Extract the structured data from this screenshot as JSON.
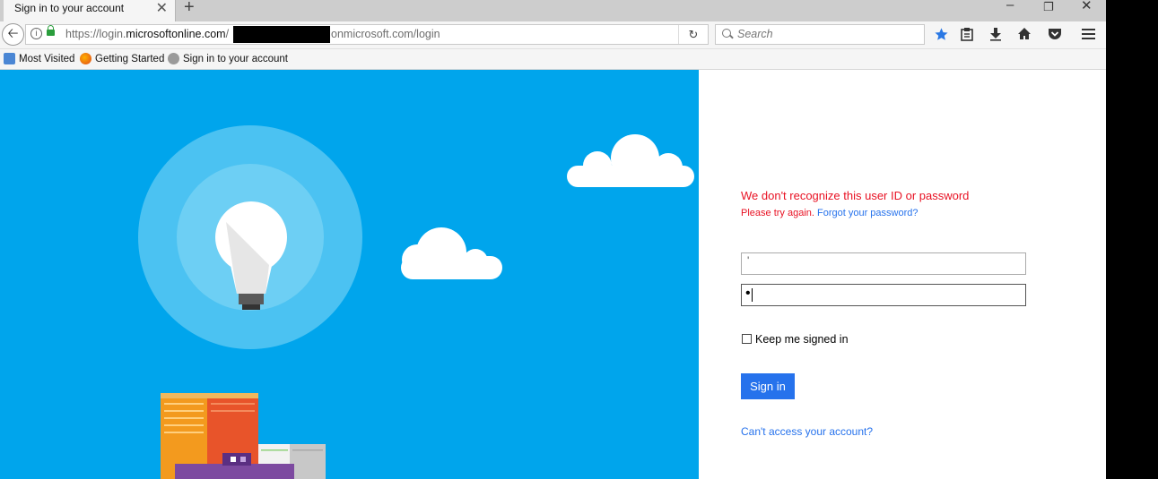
{
  "browser": {
    "tab_title": "Sign in to your account",
    "tab_close": "✕",
    "new_tab": "+",
    "window_controls": {
      "minimize": "–",
      "restore": "❐",
      "close": "✕"
    },
    "back": "🡠",
    "url_host": "https://login.",
    "url_domain": "microsoftonline.com",
    "url_sep": "/",
    "url_rest": "onmicrosoft.com/login",
    "reload": "↻",
    "search_placeholder": "Search",
    "bookmarks": [
      {
        "label": "Most Visited"
      },
      {
        "label": "Getting Started"
      },
      {
        "label": "Sign in to your account"
      }
    ]
  },
  "signin": {
    "error_title": "We don't recognize this user ID or password",
    "error_retry": "Please try again.",
    "forgot_link": "Forgot your password?",
    "username_value": "'",
    "password_value": "•",
    "keep_signed_in": "Keep me signed in",
    "keep_signed_in_checked": false,
    "signin_button": "Sign in",
    "cant_access": "Can't access your account?"
  },
  "colors": {
    "hero_bg": "#00a5ec",
    "error_red": "#e81123",
    "link_blue": "#2672ec",
    "button_blue": "#2672ec"
  },
  "icons": [
    "info-icon",
    "lock-icon",
    "reload-icon",
    "search-icon",
    "bookmark-star-icon",
    "reading-list-icon",
    "download-icon",
    "home-icon",
    "pocket-icon",
    "menu-icon",
    "lightbulb-icon",
    "cloud-icon"
  ]
}
